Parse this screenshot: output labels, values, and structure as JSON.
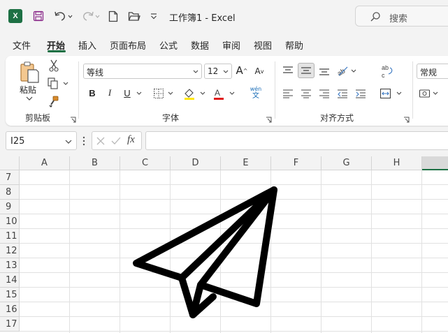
{
  "titlebar": {
    "app_icon": "X",
    "document_title": "工作簿1  -  Excel",
    "search_placeholder": "搜索",
    "icons": [
      "excel-logo",
      "save-icon",
      "undo-icon",
      "redo-icon",
      "new-file-icon",
      "open-folder-icon",
      "customize-qat-icon",
      "search-icon"
    ]
  },
  "tabs": [
    {
      "label": "文件",
      "active": false
    },
    {
      "label": "开始",
      "active": true
    },
    {
      "label": "插入",
      "active": false
    },
    {
      "label": "页面布局",
      "active": false
    },
    {
      "label": "公式",
      "active": false
    },
    {
      "label": "数据",
      "active": false
    },
    {
      "label": "审阅",
      "active": false
    },
    {
      "label": "视图",
      "active": false
    },
    {
      "label": "帮助",
      "active": false
    }
  ],
  "ribbon": {
    "clipboard": {
      "label": "剪贴板",
      "paste_label": "粘贴"
    },
    "font": {
      "label": "字体",
      "font_name": "等线",
      "font_size": "12",
      "bold": "B",
      "italic": "I",
      "underline": "U",
      "phonetic_top": "wén",
      "phonetic_bottom": "文",
      "font_color": "#e01b1b",
      "highlight_color": "#ffe600"
    },
    "alignment": {
      "label": "对齐方式",
      "wrap_text": "ab\nc"
    },
    "number": {
      "format": "常规"
    }
  },
  "formula_bar": {
    "name_box": "I25",
    "formula": "",
    "fx_label": "fx"
  },
  "grid": {
    "columns": [
      "A",
      "B",
      "C",
      "D",
      "E",
      "F",
      "G",
      "H"
    ],
    "rows": [
      "7",
      "8",
      "9",
      "10",
      "11",
      "12",
      "13",
      "14",
      "15",
      "16",
      "17"
    ],
    "selected_column_color": "#1d7044"
  },
  "drawing": {
    "shape": "paper-plane-icon"
  },
  "colors": {
    "brand": "#1d7044",
    "background": "#f3f3f3"
  }
}
